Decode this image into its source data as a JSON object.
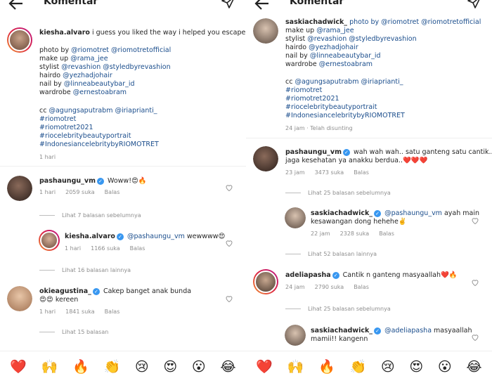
{
  "header": {
    "title": "Komentar"
  },
  "left": {
    "caption": {
      "username": "kiesha.alvaro",
      "text": "i guess you liked the way i helped you escape",
      "lines": [
        [
          "photo by ",
          "@riomotret @riomotretofficial"
        ],
        [
          "make up ",
          "@rama_jee"
        ],
        [
          "stylist ",
          "@revashion @styledbyrevashion"
        ],
        [
          "hairdo ",
          "@yezhadjohair"
        ],
        [
          "nail by ",
          "@linneabeautybar_id"
        ],
        [
          "wardrobe ",
          "@ernestoabram"
        ]
      ],
      "cc_prefix": "cc ",
      "cc_tags": "@agungsaputrabm @iriaprianti_",
      "hashtags": [
        "#riomotret",
        "#riomotret2021",
        "#riocelebritybeautyportrait",
        "#IndonesiancelebritybyRIOMOTRET"
      ],
      "time": "1 hari"
    },
    "comments": [
      {
        "username": "pashaungu_vm",
        "text": "Woww!😍🔥",
        "time": "1 hari",
        "likes": "2059 suka",
        "reply": "Balas"
      },
      {
        "view_more": "Lihat 7 balasan sebelumnya"
      },
      {
        "username": "kiesha.alvaro",
        "mention": "@pashaungu_vm",
        "text": " wewwww😍",
        "time": "1 hari",
        "likes": "1166 suka",
        "reply": "Balas"
      },
      {
        "view_more": "Lihat 16 balasan lainnya"
      },
      {
        "username": "okieagustina_",
        "text": "Cakep banget anak bunda",
        "text2": "😍😍 kereen",
        "time": "1 hari",
        "likes": "1841 suka",
        "reply": "Balas"
      },
      {
        "view_more": "Lihat 15 balasan"
      }
    ]
  },
  "right": {
    "caption": {
      "username": "saskiachadwick_",
      "first_line_tag": "photo by @riomotret @riomotretofficial",
      "lines": [
        [
          "make up ",
          "@rama_jee"
        ],
        [
          "stylist ",
          "@revashion @styledbyrevashion"
        ],
        [
          "hairdo ",
          "@yezhadjohair"
        ],
        [
          "nail by ",
          "@linneabeautybar_id"
        ],
        [
          "wardrobe ",
          "@ernestoabram"
        ]
      ],
      "cc_prefix": "cc ",
      "cc_tags": "@agungsaputrabm @iriaprianti_",
      "hashtags": [
        "#riomotret",
        "#riomotret2021",
        "#riocelebritybeautyportrait",
        "#IndonesiancelebritybyRIOMOTRET"
      ],
      "time": "24 jam · Telah disunting"
    },
    "comments": [
      {
        "username": "pashaungu_vm",
        "text": "wah wah wah.. satu ganteng satu cantik..",
        "text2": "jaga kesehatan ya anakku berdua..❤️❤️❤️",
        "time": "23 jam",
        "likes": "3473 suka",
        "reply": "Balas"
      },
      {
        "view_more": "Lihat 25 balasan sebelumnya"
      },
      {
        "username": "saskiachadwick_",
        "mention": "@pashaungu_vm",
        "text": " ayah main",
        "text2": "kesawangan dong hehehe✌️",
        "time": "22 jam",
        "likes": "2328 suka",
        "reply": "Balas"
      },
      {
        "view_more": "Lihat 52 balasan lainnya"
      },
      {
        "username": "adeliapasha",
        "text": "Cantik n ganteng masyaallah❤️🔥",
        "time": "24 jam",
        "likes": "2790 suka",
        "reply": "Balas"
      },
      {
        "view_more": "Lihat 25 balasan sebelumnya"
      },
      {
        "username": "saskiachadwick_",
        "mention": "@adeliapasha",
        "text": " masyaallah",
        "text2": "mamii!! kangenn",
        "time": "",
        "likes": "",
        "reply": ""
      }
    ]
  },
  "emoji_bar": [
    "❤️",
    "🙌",
    "🔥",
    "👏",
    "😢",
    "😍",
    "😮",
    "😂"
  ]
}
